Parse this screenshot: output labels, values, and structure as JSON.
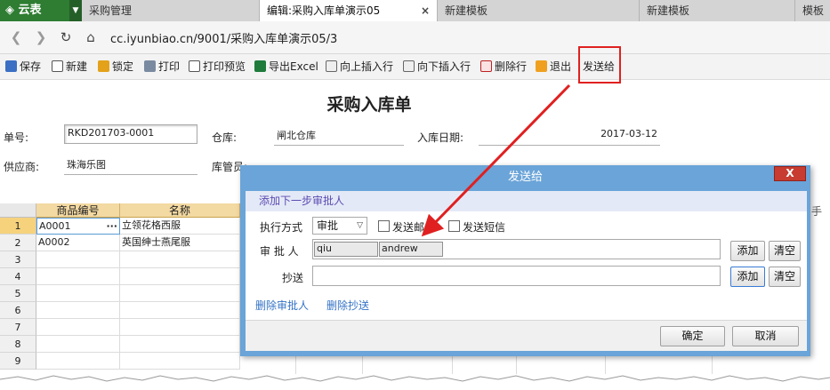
{
  "tabs": {
    "brand": "云表",
    "items": [
      "采购管理",
      "编辑:采购入库单演示05",
      "新建模板",
      "新建模板",
      "模板"
    ],
    "active_close": "×"
  },
  "address": {
    "url": "cc.iyunbiao.cn/9001/采购入库单演示05/3"
  },
  "toolbar": {
    "save": "保存",
    "new": "新建",
    "lock": "锁定",
    "print": "打印",
    "preview": "打印预览",
    "excel": "导出Excel",
    "insert_up": "向上插入行",
    "insert_down": "向下插入行",
    "delete_row": "删除行",
    "exit": "退出",
    "send_to": "发送给"
  },
  "form": {
    "title": "采购入库单",
    "number_label": "单号:",
    "number_value": "RKD201703-0001",
    "warehouse_label": "仓库:",
    "warehouse_value": "闸北仓库",
    "date_label": "入库日期:",
    "date_value": "2017-03-12",
    "supplier_label": "供应商:",
    "supplier_value": "珠海乐图",
    "keeper_label": "库管员:"
  },
  "grid": {
    "headers": [
      "商品编号",
      "名称"
    ],
    "rows": [
      {
        "num": "1",
        "code": "A0001",
        "name": "立领花格西服"
      },
      {
        "num": "2",
        "code": "A0002",
        "name": "英国绅士燕尾服"
      },
      {
        "num": "3"
      },
      {
        "num": "4"
      },
      {
        "num": "5"
      },
      {
        "num": "6"
      },
      {
        "num": "7"
      },
      {
        "num": "8"
      },
      {
        "num": "9"
      }
    ],
    "ellipsis": "···",
    "side_fragment": "手"
  },
  "dialog": {
    "title": "发送给",
    "close": "X",
    "section": "添加下一步审批人",
    "mode_label": "执行方式",
    "mode_value": "审批",
    "send_email": "发送邮件",
    "send_sms": "发送短信",
    "approver_label": "审 批 人",
    "approvers": [
      "qiu",
      "andrew"
    ],
    "cc_label": "抄送",
    "add": "添加",
    "clear": "清空",
    "delete_approver": "删除审批人",
    "delete_cc": "删除抄送",
    "ok": "确定",
    "cancel": "取消"
  },
  "colors": {
    "brand": "#2e7d32",
    "dialog_frame": "#6aa4d8",
    "highlight": "#e02020",
    "grid_header": "#f3d9a2",
    "link": "#3473c6"
  }
}
